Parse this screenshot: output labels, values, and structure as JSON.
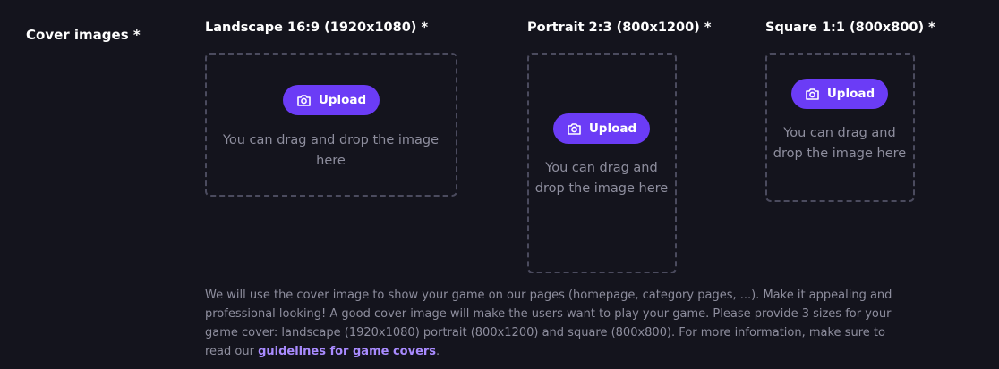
{
  "section": {
    "label": "Cover images *"
  },
  "slots": [
    {
      "title": "Landscape 16:9 (1920x1080) *",
      "button_label": "Upload",
      "hint": "You can drag and drop the image here",
      "icon": "camera-icon"
    },
    {
      "title": "Portrait 2:3 (800x1200) *",
      "button_label": "Upload",
      "hint": "You can drag and drop the image here",
      "icon": "camera-icon"
    },
    {
      "title": "Square 1:1 (800x800) *",
      "button_label": "Upload",
      "hint": "You can drag and drop the image here",
      "icon": "camera-icon"
    }
  ],
  "description": {
    "text": "We will use the cover image to show your game on our pages (homepage, category pages, ...). Make it appealing and professional looking! A good cover image will make the users want to play your game. Please provide 3 sizes for your game cover: landscape (1920x1080) portrait (800x1200) and square (800x800). For more information, make sure to read our ",
    "link_text": "guidelines for game covers",
    "suffix": "."
  },
  "colors": {
    "background": "#14141d",
    "accent": "#6b3cf6",
    "link": "#a98bff",
    "muted_text": "#8e8e9e",
    "dashed_border": "#4b4b5e"
  }
}
